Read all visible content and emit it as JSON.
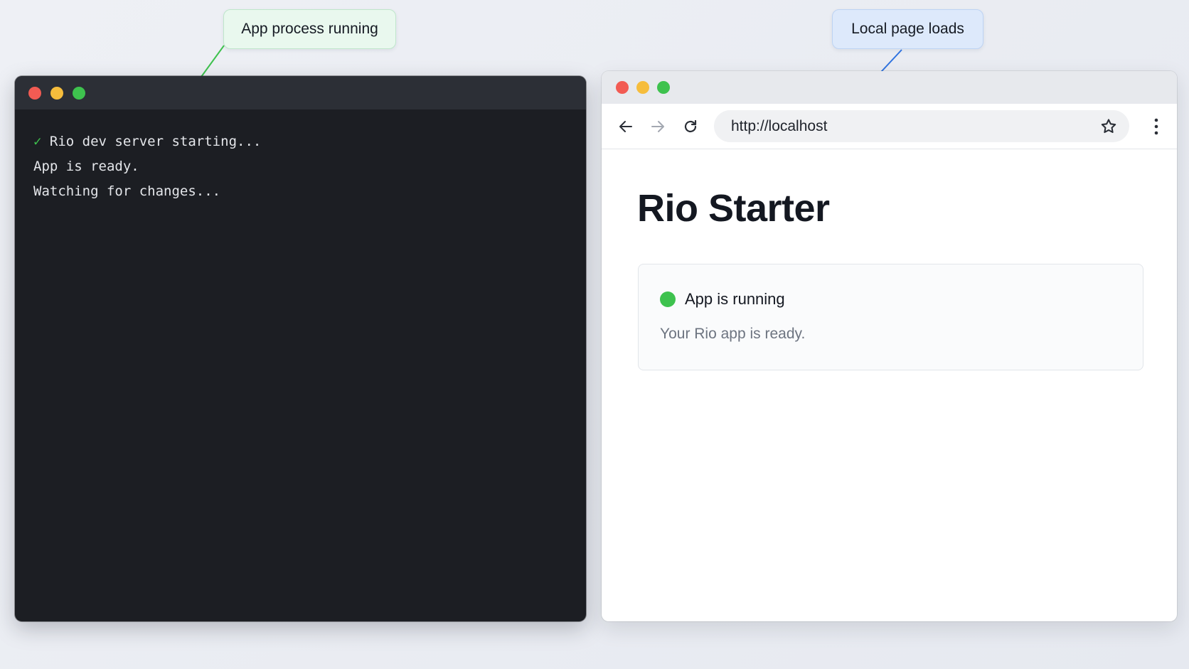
{
  "callouts": {
    "left": "App process running",
    "right": "Local page loads"
  },
  "terminal": {
    "lines": [
      {
        "prefix": "✓",
        "text": "Rio dev server starting..."
      },
      {
        "prefix": "",
        "text": "App is ready."
      },
      {
        "prefix": "",
        "text": "Watching for changes..."
      }
    ]
  },
  "browser": {
    "url": "http://localhost",
    "page_title": "Rio Starter",
    "status": {
      "label": "App is running",
      "description": "Your Rio app is ready.",
      "color": "#3ec24e"
    }
  },
  "colors": {
    "callout_green_bg": "#e9f8ee",
    "callout_blue_bg": "#dde9fb",
    "terminal_bg": "#1c1e23",
    "traffic_red": "#f25b53",
    "traffic_yellow": "#f6bd3c",
    "traffic_green": "#3ec24e"
  }
}
